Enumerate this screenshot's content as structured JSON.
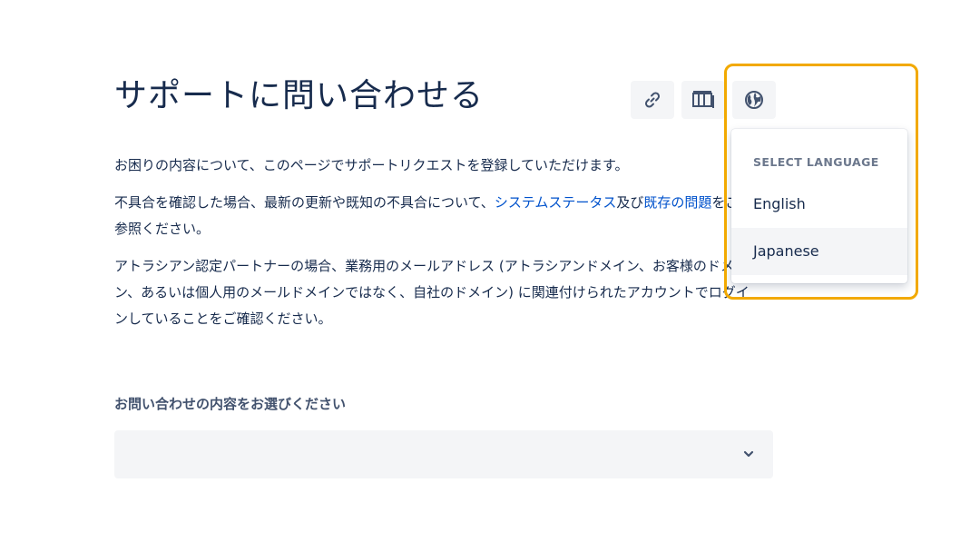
{
  "page": {
    "title": "サポートに問い合わせる",
    "intro": "お困りの内容について、このページでサポートリクエストを登録していただけます。",
    "para2_before": "不具合を確認した場合、最新の更新や既知の不具合について、",
    "para2_link1": "システムステータス",
    "para2_mid": "及",
    "para2_mid2": "び",
    "para2_link2": "既存の問題",
    "para2_after": "をご参照ください。",
    "para3": "アトラシアン認定パートナーの場合、業務用のメールアドレス (アトラシアンドメイン、お客様のドメイン、あるいは個人用のメールドメインではなく、自社のドメイン) に関連付けられたアカウントでログインしていることをご確認ください。",
    "field_label": "お問い合わせの内容をお選びください",
    "select_value": ""
  },
  "toolbar": {
    "buttons": [
      {
        "icon": "link-icon"
      },
      {
        "icon": "board-icon"
      },
      {
        "icon": "globe-icon"
      }
    ]
  },
  "language_menu": {
    "heading": "SELECT LANGUAGE",
    "items": [
      "English",
      "Japanese"
    ],
    "highlighted": "Japanese"
  },
  "colors": {
    "text": "#172b4d",
    "link": "#0052cc",
    "muted": "#6b778c",
    "field_bg": "#f4f5f7",
    "highlight_border": "#f2a900"
  }
}
